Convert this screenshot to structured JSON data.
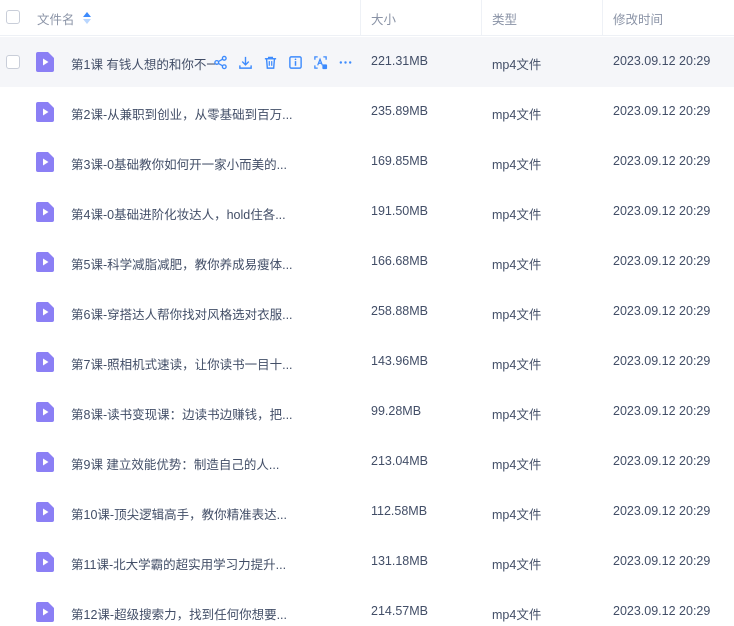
{
  "header": {
    "name": "文件名",
    "size": "大小",
    "type": "类型",
    "time": "修改时间"
  },
  "colors": {
    "accent": "#3d8bfd",
    "file_icon": "#8b7ff5",
    "hover_row": "#f5f6f9"
  },
  "rows": [
    {
      "name": "第1课 有钱人想的和你不一",
      "size": "221.31MB",
      "type": "mp4文件",
      "time": "2023.09.12 20:29",
      "hover": true
    },
    {
      "name": "第2课-从兼职到创业，从零基础到百万...",
      "size": "235.89MB",
      "type": "mp4文件",
      "time": "2023.09.12 20:29"
    },
    {
      "name": "第3课-0基础教你如何开一家小而美的...",
      "size": "169.85MB",
      "type": "mp4文件",
      "time": "2023.09.12 20:29"
    },
    {
      "name": "第4课-0基础进阶化妆达人，hold住各...",
      "size": "191.50MB",
      "type": "mp4文件",
      "time": "2023.09.12 20:29"
    },
    {
      "name": "第5课-科学减脂减肥，教你养成易瘦体...",
      "size": "166.68MB",
      "type": "mp4文件",
      "time": "2023.09.12 20:29"
    },
    {
      "name": "第6课-穿搭达人帮你找对风格选对衣服...",
      "size": "258.88MB",
      "type": "mp4文件",
      "time": "2023.09.12 20:29"
    },
    {
      "name": "第7课-照相机式速读，让你读书一目十...",
      "size": "143.96MB",
      "type": "mp4文件",
      "time": "2023.09.12 20:29"
    },
    {
      "name": "第8课-读书变现课：边读书边赚钱，把...",
      "size": "99.28MB",
      "type": "mp4文件",
      "time": "2023.09.12 20:29"
    },
    {
      "name": "第9课 建立效能优势：制造自己的人...",
      "size": "213.04MB",
      "type": "mp4文件",
      "time": "2023.09.12 20:29"
    },
    {
      "name": "第10课-顶尖逻辑高手，教你精准表达...",
      "size": "112.58MB",
      "type": "mp4文件",
      "time": "2023.09.12 20:29"
    },
    {
      "name": "第11课-北大学霸的超实用学习力提升...",
      "size": "131.18MB",
      "type": "mp4文件",
      "time": "2023.09.12 20:29"
    },
    {
      "name": "第12课-超级搜索力，找到任何你想要...",
      "size": "214.57MB",
      "type": "mp4文件",
      "time": "2023.09.12 20:29"
    }
  ],
  "row_actions": [
    "share-icon",
    "download-icon",
    "delete-icon",
    "info-icon",
    "text-recognize-icon",
    "more-icon"
  ]
}
